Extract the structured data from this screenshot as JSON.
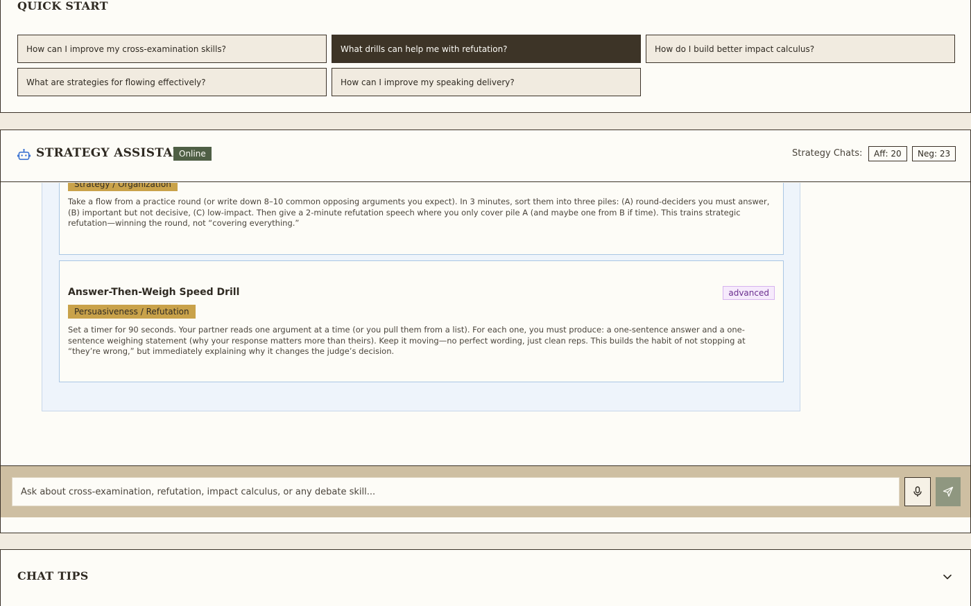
{
  "quick_start": {
    "title": "QUICK START",
    "buttons": [
      {
        "label": "How can I improve my cross-examination skills?"
      },
      {
        "label": "What drills can help me with refutation?"
      },
      {
        "label": "How do I build better impact calculus?"
      },
      {
        "label": "What are strategies for flowing effectively?"
      },
      {
        "label": "How can I improve my speaking delivery?"
      }
    ],
    "active_index": 1
  },
  "assistant": {
    "title": "STRATEGY ASSISTANT",
    "status": "Online",
    "chats_label": "Strategy Chats:",
    "aff": "Aff: 20",
    "neg": "Neg: 23",
    "icon": "robot-icon",
    "drills": [
      {
        "category": "Strategy / Organization",
        "description": "Take a flow from a practice round (or write down 8–10 common opposing arguments you expect). In 3 minutes, sort them into three piles: (A) round-deciders you must answer, (B) important but not decisive, (C) low-impact. Then give a 2-minute refutation speech where you only cover pile A (and maybe one from B if time). This trains strategic refutation—winning the round, not “covering everything.”"
      },
      {
        "title": "Answer-Then-Weigh Speed Drill",
        "level": "advanced",
        "category": "Persuasiveness / Refutation",
        "description": "Set a timer for 90 seconds. Your partner reads one argument at a time (or you pull them from a list). For each one, you must produce: a one-sentence answer and a one-sentence weighing statement (why your response matters more than theirs). Keep it moving—no perfect wording, just clean reps. This builds the habit of not stopping at “they’re wrong,” but immediately explaining why it changes the judge’s decision."
      }
    ]
  },
  "input": {
    "placeholder": "Ask about cross-examination, refutation, impact calculus, or any debate skill..."
  },
  "icons": {
    "mic": "microphone-icon",
    "send": "send-icon",
    "chevron": "chevron-down-icon"
  },
  "chat_tips": {
    "title": "CHAT TIPS"
  },
  "colors": {
    "dark": "#3d3427",
    "panel": "#fdfcf7",
    "background": "#f1ebe0",
    "status_green": "#4f5f45",
    "category_gold": "#c9a24a",
    "input_bar": "#cebfa2",
    "send_button": "#8f9780",
    "level_purple": "#6a2f8e"
  }
}
